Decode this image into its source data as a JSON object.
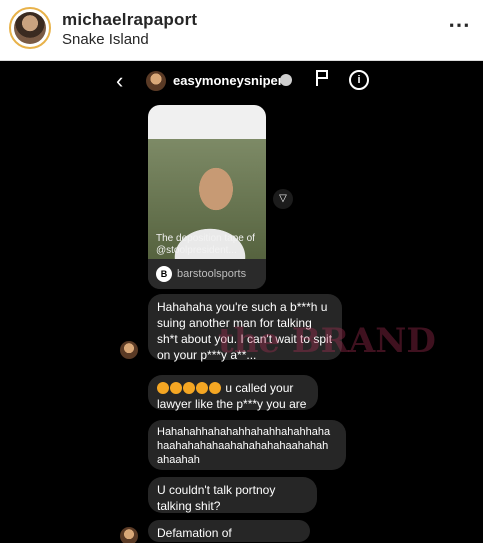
{
  "post": {
    "username": "michaelrapaport",
    "location": "Snake Island",
    "more_icon": "⋯"
  },
  "dm": {
    "username": "easymoneysniper",
    "back_icon": "‹",
    "info_icon": "i",
    "shared_post": {
      "caption": "The deposition tape of @stoolpresident...",
      "source": "barstoolsports",
      "logo_text": "B"
    },
    "messages": [
      "Hahahaha you're such a b***h u suing another man for talking sh*t about you. I can't wait to spit on your p***y a**...",
      "u called your lawyer like the p***y you are",
      "Hahahahhahahahhahahhahahhaha haahahahahaahahahahahaahahah ahaahah",
      "U couldn't talk portnoy talking shit?",
      "Defamation of character???"
    ],
    "watermark": "the BRAND"
  },
  "colors": {
    "dm_bg": "#000000",
    "bubble": "#262626",
    "avatar_ring": "#e8b24a"
  }
}
